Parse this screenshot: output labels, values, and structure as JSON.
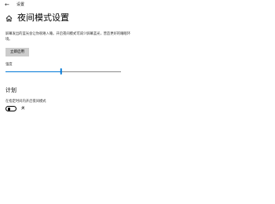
{
  "window": {
    "back_icon": "back-arrow-icon",
    "title": "设置"
  },
  "header": {
    "home_icon": "home-icon",
    "page_title": "夜间模式设置"
  },
  "description": "屏幕发出的蓝光会让你很难入睡。开启夜间模式可减少屏幕蓝光，营造更好的睡眠环境。",
  "enable_button": {
    "label": "立即启用"
  },
  "strength": {
    "label": "强度",
    "value_fraction": 0.48,
    "accent_color": "#0078d7"
  },
  "schedule": {
    "section_title": "计划",
    "label": "在指定时间内开启夜间模式",
    "toggle_state": "关",
    "toggle_on": false
  }
}
